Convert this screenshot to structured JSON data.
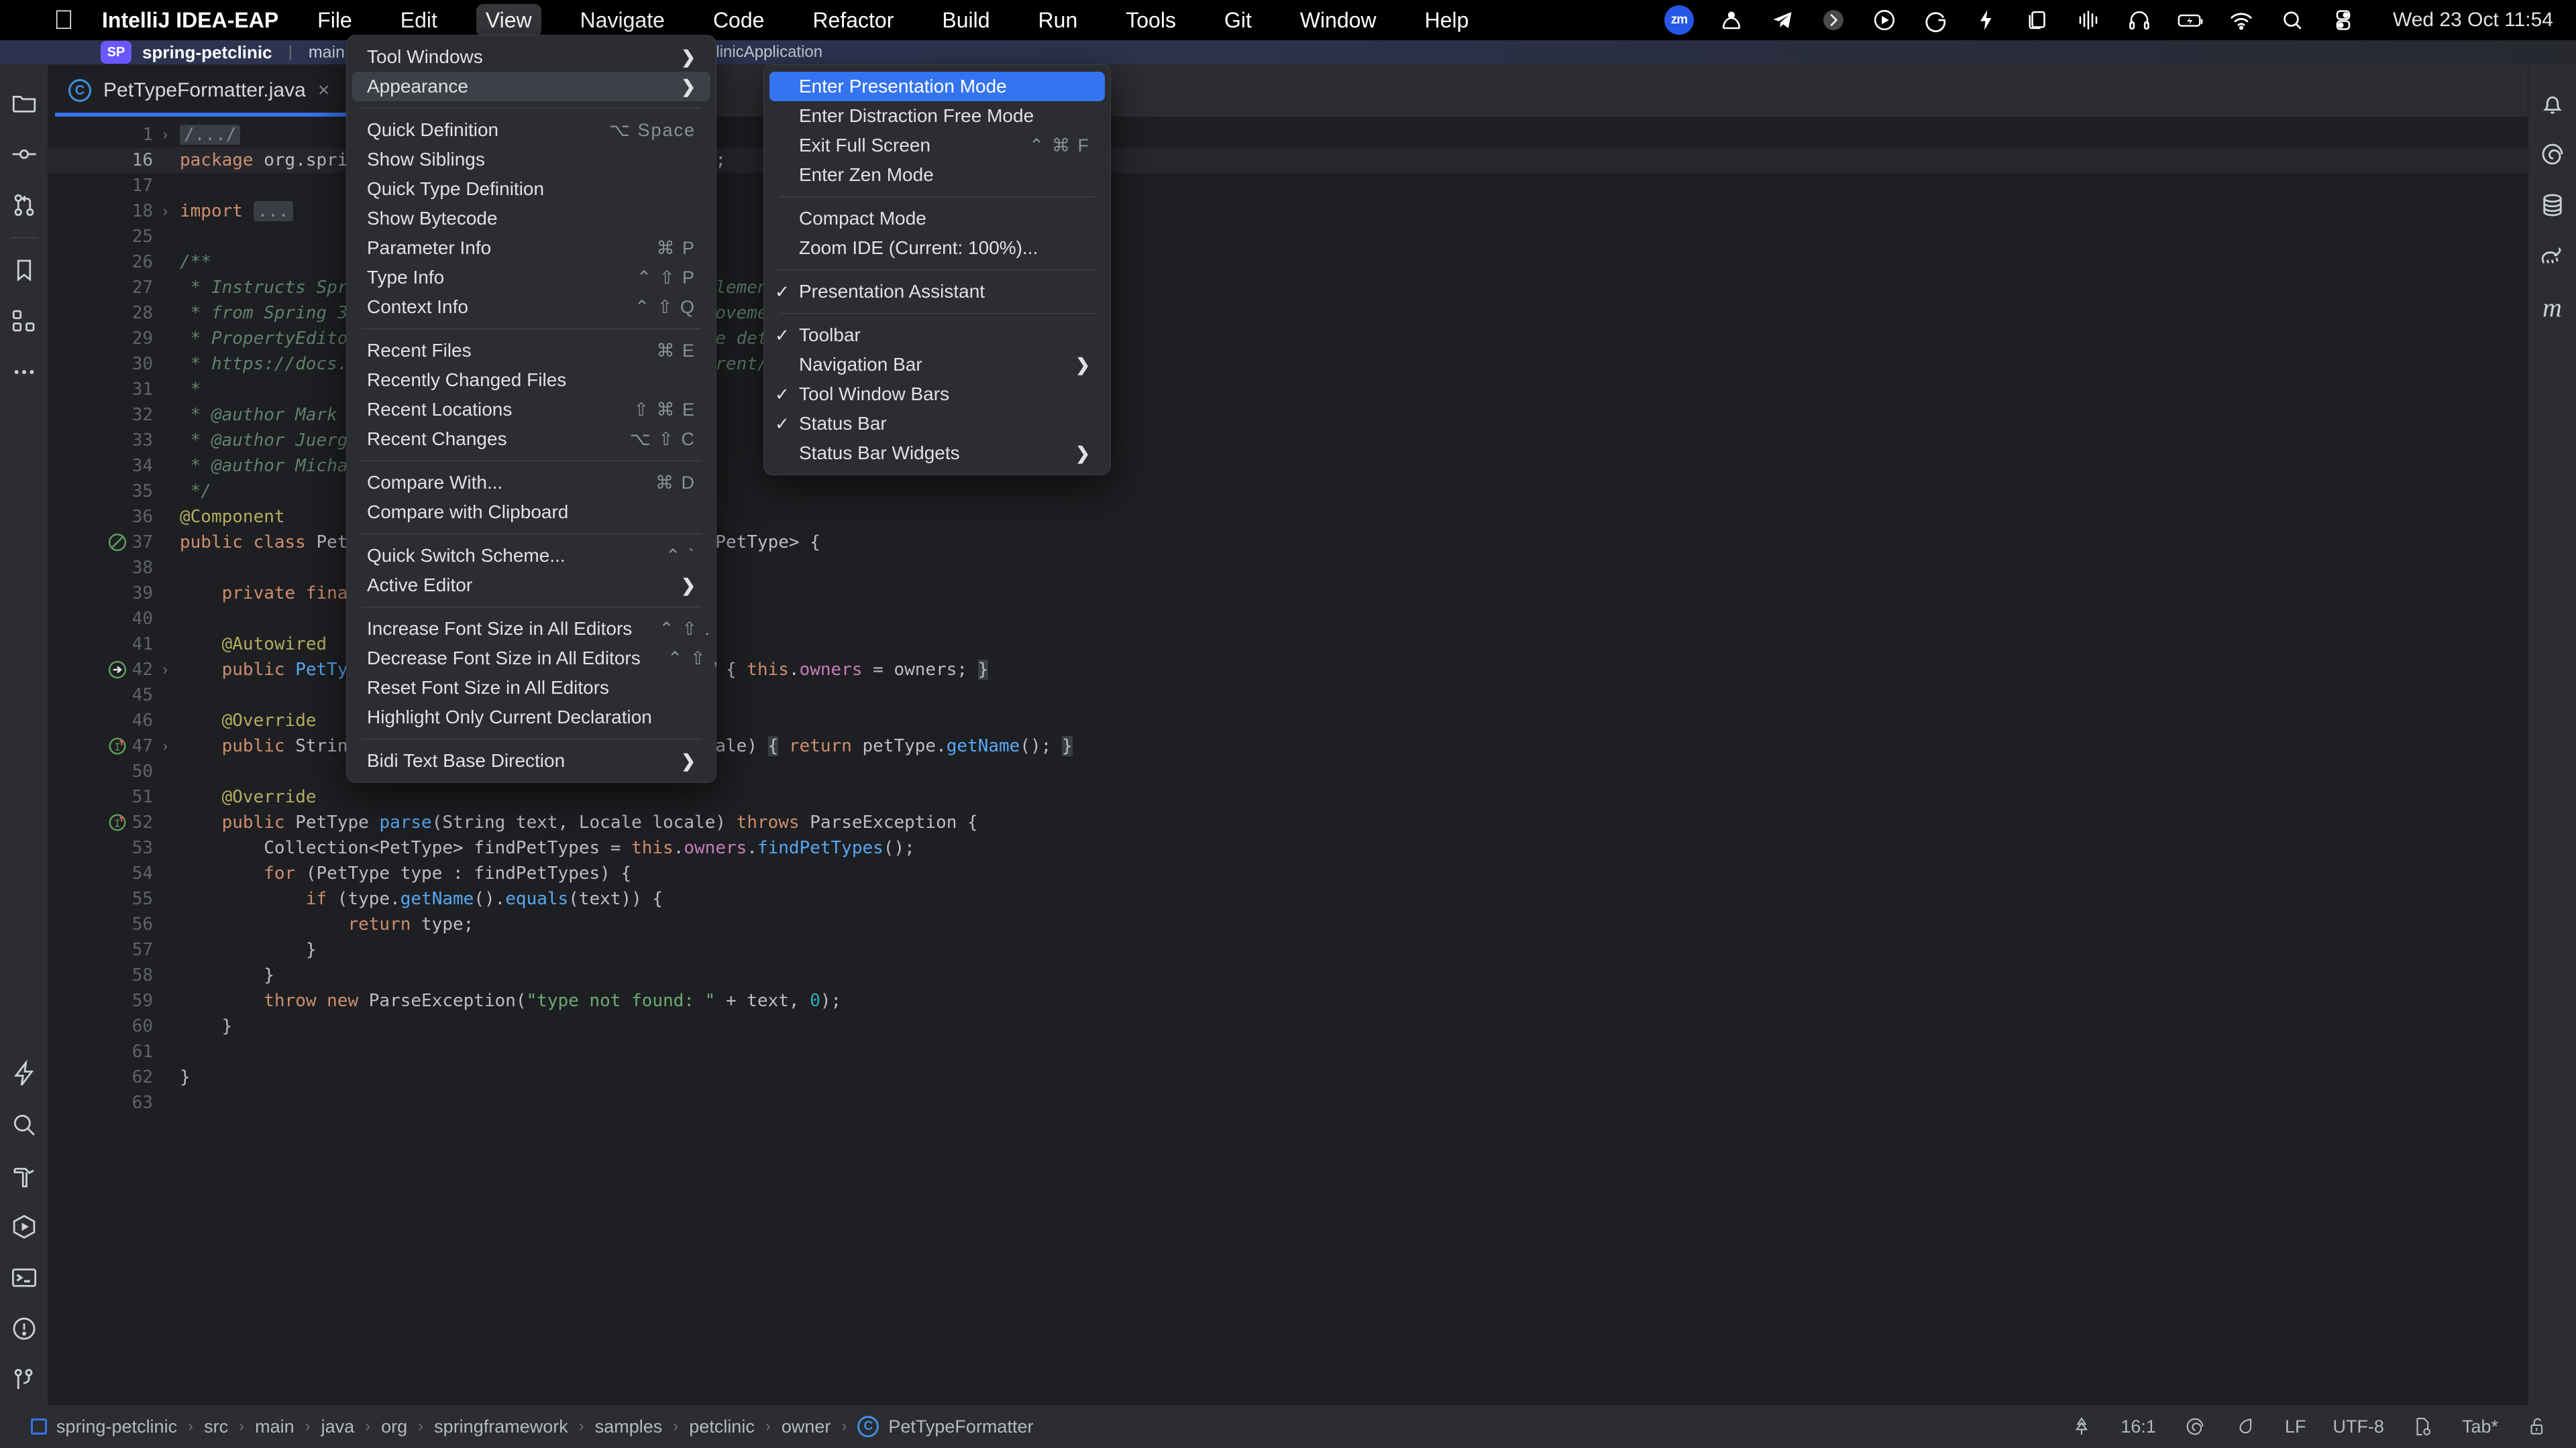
{
  "macbar": {
    "app_name": "IntelliJ IDEA-EAP",
    "items": [
      "File",
      "Edit",
      "View",
      "Navigate",
      "Code",
      "Refactor",
      "Build",
      "Run",
      "Tools",
      "Git",
      "Window",
      "Help"
    ],
    "active_item": "View",
    "apple_logo": "apple-logo",
    "clock": "Wed 23 Oct  11:54",
    "tray": [
      {
        "name": "zoom-icon",
        "label": "zm"
      },
      {
        "name": "arc-browser-icon",
        "label": ""
      },
      {
        "name": "telegram-icon",
        "label": ""
      },
      {
        "name": "shottr-icon",
        "label": ""
      },
      {
        "name": "orbstack-icon",
        "label": ""
      },
      {
        "name": "grammarly-icon",
        "label": ""
      },
      {
        "name": "raycast-icon",
        "label": ""
      },
      {
        "name": "rectangle-icon",
        "label": ""
      },
      {
        "name": "audio-levels-icon",
        "label": ""
      },
      {
        "name": "headphones-icon",
        "label": ""
      },
      {
        "name": "battery-charging-icon",
        "label": ""
      },
      {
        "name": "wifi-icon",
        "label": ""
      },
      {
        "name": "spotlight-search-icon",
        "label": ""
      },
      {
        "name": "control-center-icon",
        "label": ""
      }
    ]
  },
  "ide_toolbar": {
    "project_badge": "SP",
    "project_name": "spring-petclinic",
    "branch": "main",
    "run_config": "PetClinicApplication"
  },
  "editor_tab": {
    "icon": "java-class-icon",
    "label": "PetTypeFormatter.java",
    "close": "×"
  },
  "left_toolwindow_bar": {
    "top": [
      {
        "name": "project-icon",
        "title": "Project"
      },
      {
        "name": "commit-icon",
        "title": "Commit"
      },
      {
        "name": "pull-requests-icon",
        "title": "Pull Requests"
      },
      {
        "name": "bookmarks-icon",
        "title": "Bookmarks"
      },
      {
        "name": "structure-icon",
        "title": "Structure"
      },
      {
        "name": "more-tool-windows-icon",
        "title": "More"
      }
    ],
    "bottom": [
      {
        "name": "ai-assistant-icon",
        "title": "AI Assistant"
      },
      {
        "name": "find-icon",
        "title": "Find"
      },
      {
        "name": "build-icon",
        "title": "Build"
      },
      {
        "name": "run-icon",
        "title": "Run"
      },
      {
        "name": "terminal-icon",
        "title": "Terminal"
      },
      {
        "name": "problems-icon",
        "title": "Problems"
      },
      {
        "name": "version-control-icon",
        "title": "Version Control"
      }
    ]
  },
  "right_toolwindow_bar": [
    {
      "name": "notifications-bell-icon",
      "title": "Notifications"
    },
    {
      "name": "spring-icon",
      "title": "Spring"
    },
    {
      "name": "database-icon",
      "title": "Database"
    },
    {
      "name": "gradle-icon",
      "title": "Gradle"
    },
    {
      "name": "maven-icon",
      "title": "Maven"
    }
  ],
  "view_menu": {
    "items": [
      {
        "label": "Tool Windows",
        "shortcut": "",
        "submenu": true,
        "state": "normal"
      },
      {
        "label": "Appearance",
        "shortcut": "",
        "submenu": true,
        "state": "hover"
      },
      {
        "separator": true
      },
      {
        "label": "Quick Definition",
        "shortcut": "⌥ Space",
        "submenu": false,
        "state": "normal"
      },
      {
        "label": "Show Siblings",
        "shortcut": "",
        "submenu": false,
        "state": "normal"
      },
      {
        "label": "Quick Type Definition",
        "shortcut": "",
        "submenu": false,
        "state": "normal"
      },
      {
        "label": "Show Bytecode",
        "shortcut": "",
        "submenu": false,
        "state": "normal"
      },
      {
        "label": "Parameter Info",
        "shortcut": "⌘ P",
        "submenu": false,
        "state": "normal"
      },
      {
        "label": "Type Info",
        "shortcut": "⌃ ⇧ P",
        "submenu": false,
        "state": "normal"
      },
      {
        "label": "Context Info",
        "shortcut": "⌃ ⇧ Q",
        "submenu": false,
        "state": "normal"
      },
      {
        "separator": true
      },
      {
        "label": "Recent Files",
        "shortcut": "⌘ E",
        "submenu": false,
        "state": "normal"
      },
      {
        "label": "Recently Changed Files",
        "shortcut": "",
        "submenu": false,
        "state": "normal"
      },
      {
        "label": "Recent Locations",
        "shortcut": "⇧ ⌘ E",
        "submenu": false,
        "state": "normal"
      },
      {
        "label": "Recent Changes",
        "shortcut": "⌥ ⇧ C",
        "submenu": false,
        "state": "normal"
      },
      {
        "separator": true
      },
      {
        "label": "Compare With...",
        "shortcut": "⌘ D",
        "submenu": false,
        "state": "normal"
      },
      {
        "label": "Compare with Clipboard",
        "shortcut": "",
        "submenu": false,
        "state": "normal"
      },
      {
        "separator": true
      },
      {
        "label": "Quick Switch Scheme...",
        "shortcut": "⌃ `",
        "submenu": false,
        "state": "normal"
      },
      {
        "label": "Active Editor",
        "shortcut": "",
        "submenu": true,
        "state": "normal"
      },
      {
        "separator": true
      },
      {
        "label": "Increase Font Size in All Editors",
        "shortcut": "⌃ ⇧ .",
        "submenu": false,
        "state": "normal"
      },
      {
        "label": "Decrease Font Size in All Editors",
        "shortcut": "⌃ ⇧ ,",
        "submenu": false,
        "state": "normal"
      },
      {
        "label": "Reset Font Size in All Editors",
        "shortcut": "",
        "submenu": false,
        "state": "normal"
      },
      {
        "label": "Highlight Only Current Declaration",
        "shortcut": "",
        "submenu": false,
        "state": "normal"
      },
      {
        "separator": true
      },
      {
        "label": "Bidi Text Base Direction",
        "shortcut": "",
        "submenu": true,
        "state": "normal"
      }
    ]
  },
  "appearance_menu": {
    "items": [
      {
        "label": "Enter Presentation Mode",
        "shortcut": "",
        "submenu": false,
        "checked": false,
        "state": "selected"
      },
      {
        "label": "Enter Distraction Free Mode",
        "shortcut": "",
        "submenu": false,
        "checked": false,
        "state": "normal"
      },
      {
        "label": "Exit Full Screen",
        "shortcut": "⌃ ⌘ F",
        "submenu": false,
        "checked": false,
        "state": "normal"
      },
      {
        "label": "Enter Zen Mode",
        "shortcut": "",
        "submenu": false,
        "checked": false,
        "state": "normal"
      },
      {
        "separator": true
      },
      {
        "label": "Compact Mode",
        "shortcut": "",
        "submenu": false,
        "checked": false,
        "state": "normal"
      },
      {
        "label": "Zoom IDE (Current: 100%)...",
        "shortcut": "",
        "submenu": false,
        "checked": false,
        "state": "normal"
      },
      {
        "separator": true
      },
      {
        "label": "Presentation Assistant",
        "shortcut": "",
        "submenu": false,
        "checked": true,
        "state": "normal"
      },
      {
        "separator": true
      },
      {
        "label": "Toolbar",
        "shortcut": "",
        "submenu": false,
        "checked": true,
        "state": "normal"
      },
      {
        "label": "Navigation Bar",
        "shortcut": "",
        "submenu": true,
        "checked": false,
        "state": "normal"
      },
      {
        "label": "Tool Window Bars",
        "shortcut": "",
        "submenu": false,
        "checked": true,
        "state": "normal"
      },
      {
        "label": "Status Bar",
        "shortcut": "",
        "submenu": false,
        "checked": true,
        "state": "normal"
      },
      {
        "label": "Status Bar Widgets",
        "shortcut": "",
        "submenu": true,
        "checked": false,
        "state": "normal"
      }
    ]
  },
  "code": {
    "lines": [
      {
        "num": "1",
        "fold": true,
        "hl": false,
        "mark": "",
        "html": "<span class=\"fold-box\">/.../</span>"
      },
      {
        "num": "16",
        "fold": false,
        "hl": true,
        "mark": "",
        "html": "<span class=\"kw\">package</span> org.springframework.samples.petclinic.owner;"
      },
      {
        "num": "17",
        "fold": false,
        "hl": false,
        "mark": "",
        "html": ""
      },
      {
        "num": "18",
        "fold": true,
        "hl": false,
        "mark": "",
        "html": "<span class=\"kw\">import</span> <span class=\"fold-box\">...</span>"
      },
      {
        "num": "25",
        "fold": false,
        "hl": false,
        "mark": "",
        "html": ""
      },
      {
        "num": "26",
        "fold": false,
        "hl": false,
        "mark": "",
        "html": "<span class=\"cmt\">/**</span>"
      },
      {
        "num": "27",
        "fold": false,
        "hl": false,
        "mark": "",
        "html": " <span class=\"cmt\">* Instructs Spring MVC on how to parse and print elements of type 'PetType'. Starting</span>"
      },
      {
        "num": "28",
        "fold": false,
        "hl": false,
        "mark": "",
        "html": " <span class=\"cmt\">* from Spring 3.0, Formatters have come as an improvement in comparison to legacy</span>"
      },
      {
        "num": "29",
        "fold": false,
        "hl": false,
        "mark": "",
        "html": " <span class=\"cmt\">* PropertyEditors. See the following links for more details: - The Spring ref doc:</span>"
      },
      {
        "num": "30",
        "fold": false,
        "hl": false,
        "mark": "",
        "html": " <span class=\"cmt\">* https://docs.spring.io/spring-framework/docs/current/reference/html/core.html#format</span>"
      },
      {
        "num": "31",
        "fold": false,
        "hl": false,
        "mark": "",
        "html": " <span class=\"cmt\">*</span>"
      },
      {
        "num": "32",
        "fold": false,
        "hl": false,
        "mark": "",
        "html": " <span class=\"cmt\">* @author Mark Fisher</span>"
      },
      {
        "num": "33",
        "fold": false,
        "hl": false,
        "mark": "",
        "html": " <span class=\"cmt\">* @author Juergen Hoeller</span>"
      },
      {
        "num": "34",
        "fold": false,
        "hl": false,
        "mark": "",
        "html": " <span class=\"cmt\">* @author Michael Isvy</span>"
      },
      {
        "num": "35",
        "fold": false,
        "hl": false,
        "mark": "",
        "html": " <span class=\"cmt\">*/</span>"
      },
      {
        "num": "36",
        "fold": false,
        "hl": false,
        "mark": "",
        "html": "<span class=\"ann\">@Component</span>"
      },
      {
        "num": "37",
        "fold": false,
        "hl": false,
        "mark": "bean",
        "html": "<span class=\"kw\">public class</span> PetTypeFormatter <span class=\"kw\">implements</span> Formatter&lt;PetType&gt; {"
      },
      {
        "num": "38",
        "fold": false,
        "hl": false,
        "mark": "",
        "html": ""
      },
      {
        "num": "39",
        "fold": false,
        "hl": false,
        "mark": "",
        "html": "    <span class=\"kw\">private final</span> OwnerRepository owners;"
      },
      {
        "num": "40",
        "fold": false,
        "hl": false,
        "mark": "",
        "html": ""
      },
      {
        "num": "41",
        "fold": false,
        "hl": false,
        "mark": "",
        "html": "    <span class=\"ann\">@Autowired</span>"
      },
      {
        "num": "42",
        "fold": true,
        "hl": false,
        "mark": "autowire",
        "html": "    <span class=\"kw\">public</span> <span class=\"fn\">PetTypeFormatter</span>(OwnerRepository owners) { <span class=\"kw\">this</span>.<span class=\"fld\">owners</span> = owners; <span class=\"brace-hl\">}</span>"
      },
      {
        "num": "45",
        "fold": false,
        "hl": false,
        "mark": "",
        "html": ""
      },
      {
        "num": "46",
        "fold": false,
        "hl": false,
        "mark": "",
        "html": "    <span class=\"ann\">@Override</span>"
      },
      {
        "num": "47",
        "fold": true,
        "hl": false,
        "mark": "impl",
        "html": "    <span class=\"kw\">public</span> String <span class=\"fn\">print</span>(PetType petType, Locale locale) <span class=\"brace-hl\">{</span> <span class=\"kw\">return</span> petType.<span class=\"fn\">getName</span>(); <span class=\"brace-hl\">}</span>"
      },
      {
        "num": "50",
        "fold": false,
        "hl": false,
        "mark": "",
        "html": ""
      },
      {
        "num": "51",
        "fold": false,
        "hl": false,
        "mark": "",
        "html": "    <span class=\"ann\">@Override</span>"
      },
      {
        "num": "52",
        "fold": false,
        "hl": false,
        "mark": "impl2",
        "html": "    <span class=\"kw\">public</span> PetType <span class=\"fn\">parse</span>(String text, Locale locale) <span class=\"kw\">throws</span> ParseException {"
      },
      {
        "num": "53",
        "fold": false,
        "hl": false,
        "mark": "",
        "html": "        Collection&lt;PetType&gt; findPetTypes = <span class=\"kw\">this</span>.<span class=\"fld\">owners</span>.<span class=\"fn\">findPetTypes</span>();"
      },
      {
        "num": "54",
        "fold": false,
        "hl": false,
        "mark": "",
        "html": "        <span class=\"kw\">for</span> (PetType type : findPetTypes) {"
      },
      {
        "num": "55",
        "fold": false,
        "hl": false,
        "mark": "",
        "html": "            <span class=\"kw\">if</span> (type.<span class=\"fn\">getName</span>().<span class=\"fn\">equals</span>(text)) {"
      },
      {
        "num": "56",
        "fold": false,
        "hl": false,
        "mark": "",
        "html": "                <span class=\"kw\">return</span> type;"
      },
      {
        "num": "57",
        "fold": false,
        "hl": false,
        "mark": "",
        "html": "            }"
      },
      {
        "num": "58",
        "fold": false,
        "hl": false,
        "mark": "",
        "html": "        }"
      },
      {
        "num": "59",
        "fold": false,
        "hl": false,
        "mark": "",
        "html": "        <span class=\"kw\">throw new</span> ParseException(<span class=\"str\">\"type not found: \"</span> + text, <span class=\"num\">0</span>);"
      },
      {
        "num": "60",
        "fold": false,
        "hl": false,
        "mark": "",
        "html": "    }"
      },
      {
        "num": "61",
        "fold": false,
        "hl": false,
        "mark": "",
        "html": ""
      },
      {
        "num": "62",
        "fold": false,
        "hl": false,
        "mark": "",
        "html": "}"
      },
      {
        "num": "63",
        "fold": false,
        "hl": false,
        "mark": "",
        "html": ""
      }
    ]
  },
  "statusbar": {
    "breadcrumb": [
      "spring-petclinic",
      "src",
      "main",
      "java",
      "org",
      "springframework",
      "samples",
      "petclinic",
      "owner",
      "PetTypeFormatter"
    ],
    "separator": "›",
    "right": {
      "caret_position": "16:1",
      "line_separator": "LF",
      "encoding": "UTF-8",
      "indent": "Tab*",
      "icons": [
        "git-branch-icon",
        "spring-icon",
        "inspection-icon",
        "file-settings-icon",
        "lock-icon"
      ]
    }
  },
  "colors": {
    "accent": "#3574f0",
    "menu_bg": "#2b2d30",
    "editor_bg": "#1e1f22",
    "selection": "#3574f0",
    "keyword": "#cf8e6d",
    "comment": "#5f826b",
    "string": "#6aab73",
    "annotation": "#b3ae60",
    "field": "#c77dbb",
    "number": "#2aacb8",
    "method": "#56a8f5"
  }
}
